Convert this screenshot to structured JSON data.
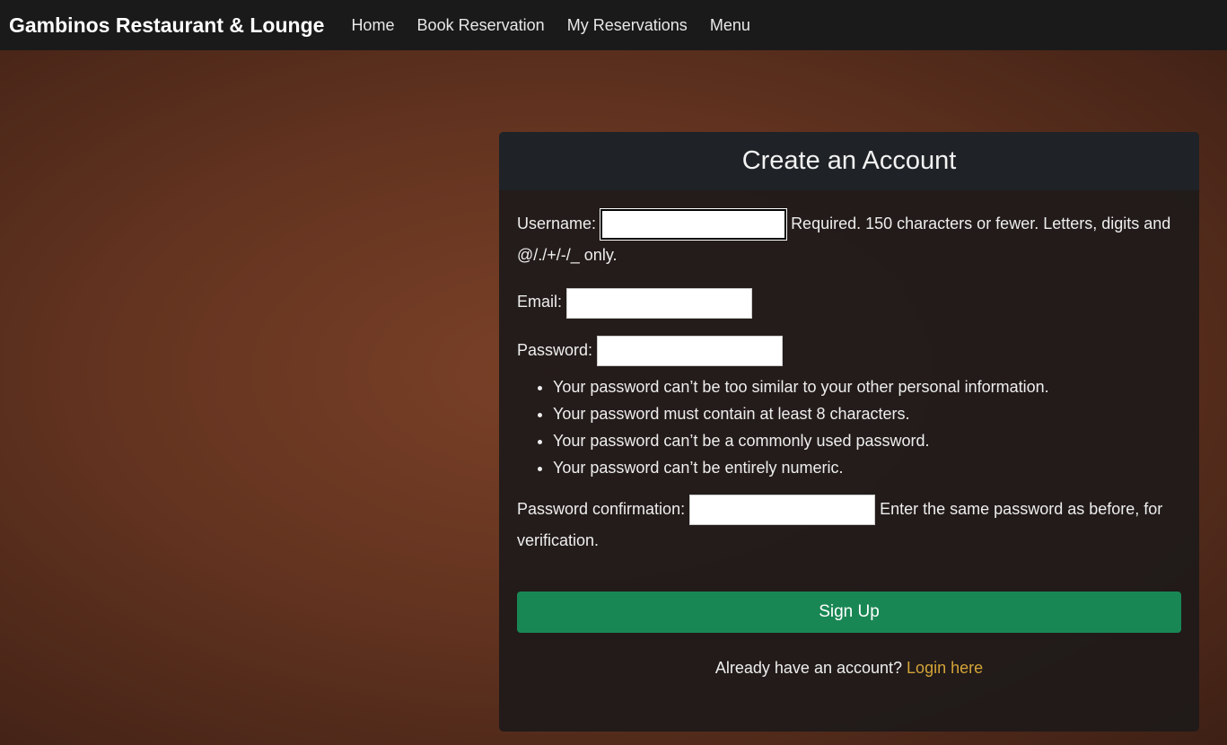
{
  "nav": {
    "brand": "Gambinos Restaurant & Lounge",
    "links": [
      "Home",
      "Book Reservation",
      "My Reservations",
      "Menu"
    ]
  },
  "form": {
    "title": "Create an Account",
    "username_label": "Username:",
    "username_help": "Required. 150 characters or fewer. Letters, digits and @/./+/-/_ only.",
    "email_label": "Email:",
    "password_label": "Password:",
    "password_rules": [
      "Your password can’t be too similar to your other personal information.",
      "Your password must contain at least 8 characters.",
      "Your password can’t be a commonly used password.",
      "Your password can’t be entirely numeric."
    ],
    "confirm_label": "Password confirmation:",
    "confirm_help": "Enter the same password as before, for verification.",
    "submit": "Sign Up",
    "login_prompt": "Already have an account?",
    "login_link": "Login here"
  }
}
